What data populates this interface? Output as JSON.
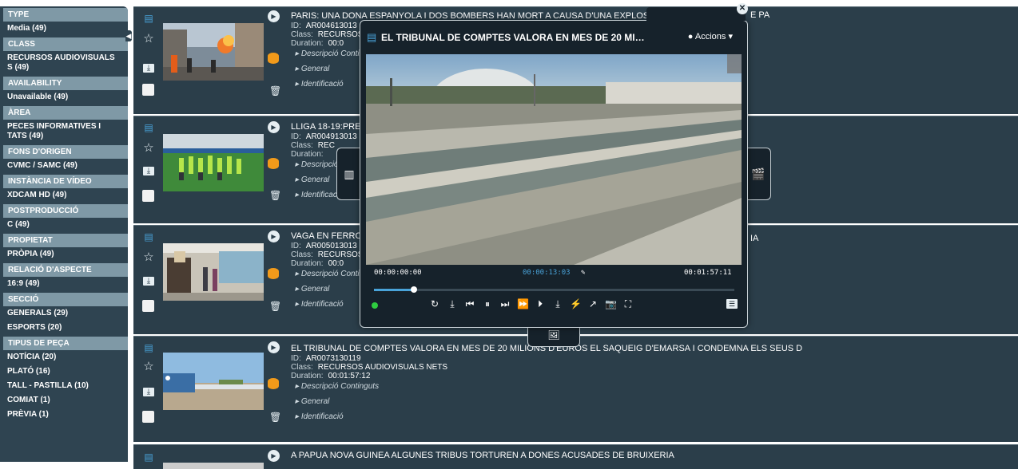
{
  "facets": [
    {
      "label": "TYPE",
      "values": [
        "Media (49)"
      ]
    },
    {
      "label": "CLASS",
      "values": [
        "RECURSOS AUDIOVISUALS\nS (49)"
      ]
    },
    {
      "label": "AVAILABILITY",
      "values": [
        "Unavailable (49)"
      ]
    },
    {
      "label": "ÀREA",
      "values": [
        "PECES INFORMATIVES I\nTATS (49)"
      ]
    },
    {
      "label": "FONS D'ORIGEN",
      "values": [
        "CVMC / SAMC (49)"
      ]
    },
    {
      "label": "INSTÀNCIA DE VÍDEO",
      "values": [
        "XDCAM HD (49)"
      ]
    },
    {
      "label": "POSTPRODUCCIÓ",
      "values": [
        "C (49)"
      ]
    },
    {
      "label": "PROPIETAT",
      "values": [
        "PRÒPIA (49)"
      ]
    },
    {
      "label": "RELACIÓ D'ASPECTE",
      "values": [
        "16:9 (49)"
      ]
    },
    {
      "label": "SECCIÓ",
      "values": [
        "GENERALS (29)",
        "ESPORTS (20)"
      ]
    },
    {
      "label": "TIPUS DE PEÇA",
      "values": [
        "NOTÍCIA (20)",
        "PLATÓ (16)",
        "TALL - PASTILLA (10)",
        "COMIAT (1)",
        "PRÈVIA (1)"
      ]
    }
  ],
  "results": [
    {
      "title": "PARIS: UNA DONA ESPANYOLA I DOS BOMBERS HAN MORT A CAUSA D'UNA EXPLOSIÓ",
      "title_tail": "E PA",
      "id": "AR004613013",
      "class": "RECURSOS AUDIOVISUALS NETS",
      "duration": "00:0",
      "acc": [
        "Descripció Continguts",
        "General",
        "Identificació"
      ]
    },
    {
      "title": "LLIGA 18-19:PRE",
      "id": "AR004913013",
      "class": "REC",
      "duration": "",
      "acc": [
        "Descripció Continguts",
        "General",
        "Identificació"
      ]
    },
    {
      "title": "VAGA EN FERRO",
      "title_tail": "IA",
      "id": "AR005013013",
      "class": "RECURSOS",
      "duration": "00:0",
      "acc": [
        "Descripció Continguts",
        "General",
        "Identificació"
      ]
    },
    {
      "title": "EL TRIBUNAL DE COMPTES VALORA EN MES DE 20 MILIONS D'EUROS EL SAQUEIG D'EMARSA I CONDEMNA ELS SEUS D",
      "id": "AR0073130119",
      "class": "RECURSOS AUDIOVISUALS NETS",
      "duration": "00:01:57:12",
      "acc": [
        "Descripció Continguts",
        "General",
        "Identificació"
      ]
    },
    {
      "title": "A PAPUA NOVA GUINEA ALGUNES TRIBUS TORTUREN A DONES ACUSADES DE BRUIXERIA"
    }
  ],
  "meta_labels": {
    "id": "ID:",
    "class": "Class:",
    "duration": "Duration:"
  },
  "player": {
    "title": "EL TRIBUNAL DE COMPTES VALORA EN MES DE 20 MI…",
    "actions_label": "Accions",
    "tc_in": "00:00:00:00",
    "tc_current": "00:00:13:03",
    "tc_total": "00:01:57:11",
    "progress": 0.11
  },
  "colors": {
    "panel": "#2b3e4a",
    "sidebar": "#2f4451",
    "facet_head": "#7f99a6",
    "accent": "#49a3d9",
    "stack": "#f29a1a"
  }
}
